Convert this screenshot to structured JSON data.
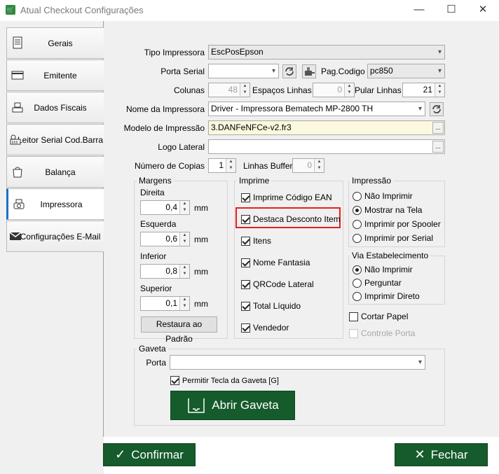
{
  "window": {
    "title": "Atual Checkout Configurações",
    "minimize": "—",
    "maximize": "☐",
    "close": "✕"
  },
  "sidebar": {
    "items": [
      {
        "label": "Gerais",
        "icon": "document-icon"
      },
      {
        "label": "Emitente",
        "icon": "card-icon"
      },
      {
        "label": "Dados Fiscais",
        "icon": "scale-icon"
      },
      {
        "label": "Leitor Serial Cod.Barra",
        "icon": "barcode-reader-icon"
      },
      {
        "label": "Balança",
        "icon": "bag-icon"
      },
      {
        "label": "Impressora",
        "icon": "scale-icon",
        "active": true
      },
      {
        "label": "Configurações E-Mail",
        "icon": "email-icon"
      }
    ]
  },
  "form": {
    "tipo_label": "Tipo Impressora",
    "tipo_value": "EscPosEpson",
    "porta_serial_label": "Porta Serial",
    "porta_serial_value": "",
    "pag_codigo_label": "Pag.Codigo",
    "pag_codigo_value": "pc850",
    "colunas_label": "Colunas",
    "colunas_value": "48",
    "espacos_label": "Espaços Linhas",
    "espacos_value": "0",
    "pular_label": "Pular Linhas",
    "pular_value": "21",
    "nome_label": "Nome da Impressora",
    "nome_value": "Driver - Impressora Bematech MP-2800 TH",
    "modelo_label": "Modelo de Impressão",
    "modelo_value": "3.DANFeNFCe-v2.fr3",
    "logo_label": "Logo Lateral",
    "logo_value": "",
    "copias_label": "Número de Copias",
    "copias_value": "1",
    "buffer_label": "Linhas Buffer",
    "buffer_value": "0",
    "ellipsis": "..."
  },
  "margens": {
    "title": "Margens",
    "unit": "mm",
    "direita_label": "Direita",
    "direita_value": "0,4",
    "esquerda_label": "Esquerda",
    "esquerda_value": "0,6",
    "inferior_label": "Inferior",
    "inferior_value": "0,8",
    "superior_label": "Superior",
    "superior_value": "0,1",
    "restaura_label": "Restaura ao Padrão"
  },
  "imprime": {
    "title": "Imprime",
    "options": [
      {
        "label": "Imprime Código EAN",
        "checked": true
      },
      {
        "label": "Destaca Desconto Item",
        "checked": true,
        "highlighted": true
      },
      {
        "label": "Itens",
        "checked": true
      },
      {
        "label": "Nome Fantasia",
        "checked": true
      },
      {
        "label": "QRCode Lateral",
        "checked": true
      },
      {
        "label": "Total Líquido",
        "checked": true
      },
      {
        "label": "Vendedor",
        "checked": true
      }
    ],
    "highlight_color": "#e81e1e"
  },
  "impressao": {
    "title": "Impressão",
    "options": [
      {
        "label": "Não Imprimir",
        "selected": false
      },
      {
        "label": "Mostrar na Tela",
        "selected": true
      },
      {
        "label": "Imprimir por Spooler",
        "selected": false
      },
      {
        "label": "Imprimir por Serial",
        "selected": false
      }
    ]
  },
  "via": {
    "title": "Via Estabelecimento",
    "options": [
      {
        "label": "Não Imprimir",
        "selected": true
      },
      {
        "label": "Perguntar",
        "selected": false
      },
      {
        "label": "Imprimir Direto",
        "selected": false
      }
    ]
  },
  "extras": {
    "cortar_label": "Cortar Papel",
    "cortar_checked": false,
    "controle_label": "Controle Porta",
    "controle_checked": false
  },
  "gaveta": {
    "title": "Gaveta",
    "porta_label": "Porta",
    "porta_value": "",
    "permitir_label": "Permitir Tecla da Gaveta [G]",
    "permitir_checked": true,
    "abrir_label": "Abrir Gaveta"
  },
  "footer": {
    "confirmar_label": "Confirmar",
    "fechar_label": "Fechar"
  },
  "colors": {
    "accent_green": "#155b2b",
    "active_tab_bar": "#1f6fc5"
  }
}
